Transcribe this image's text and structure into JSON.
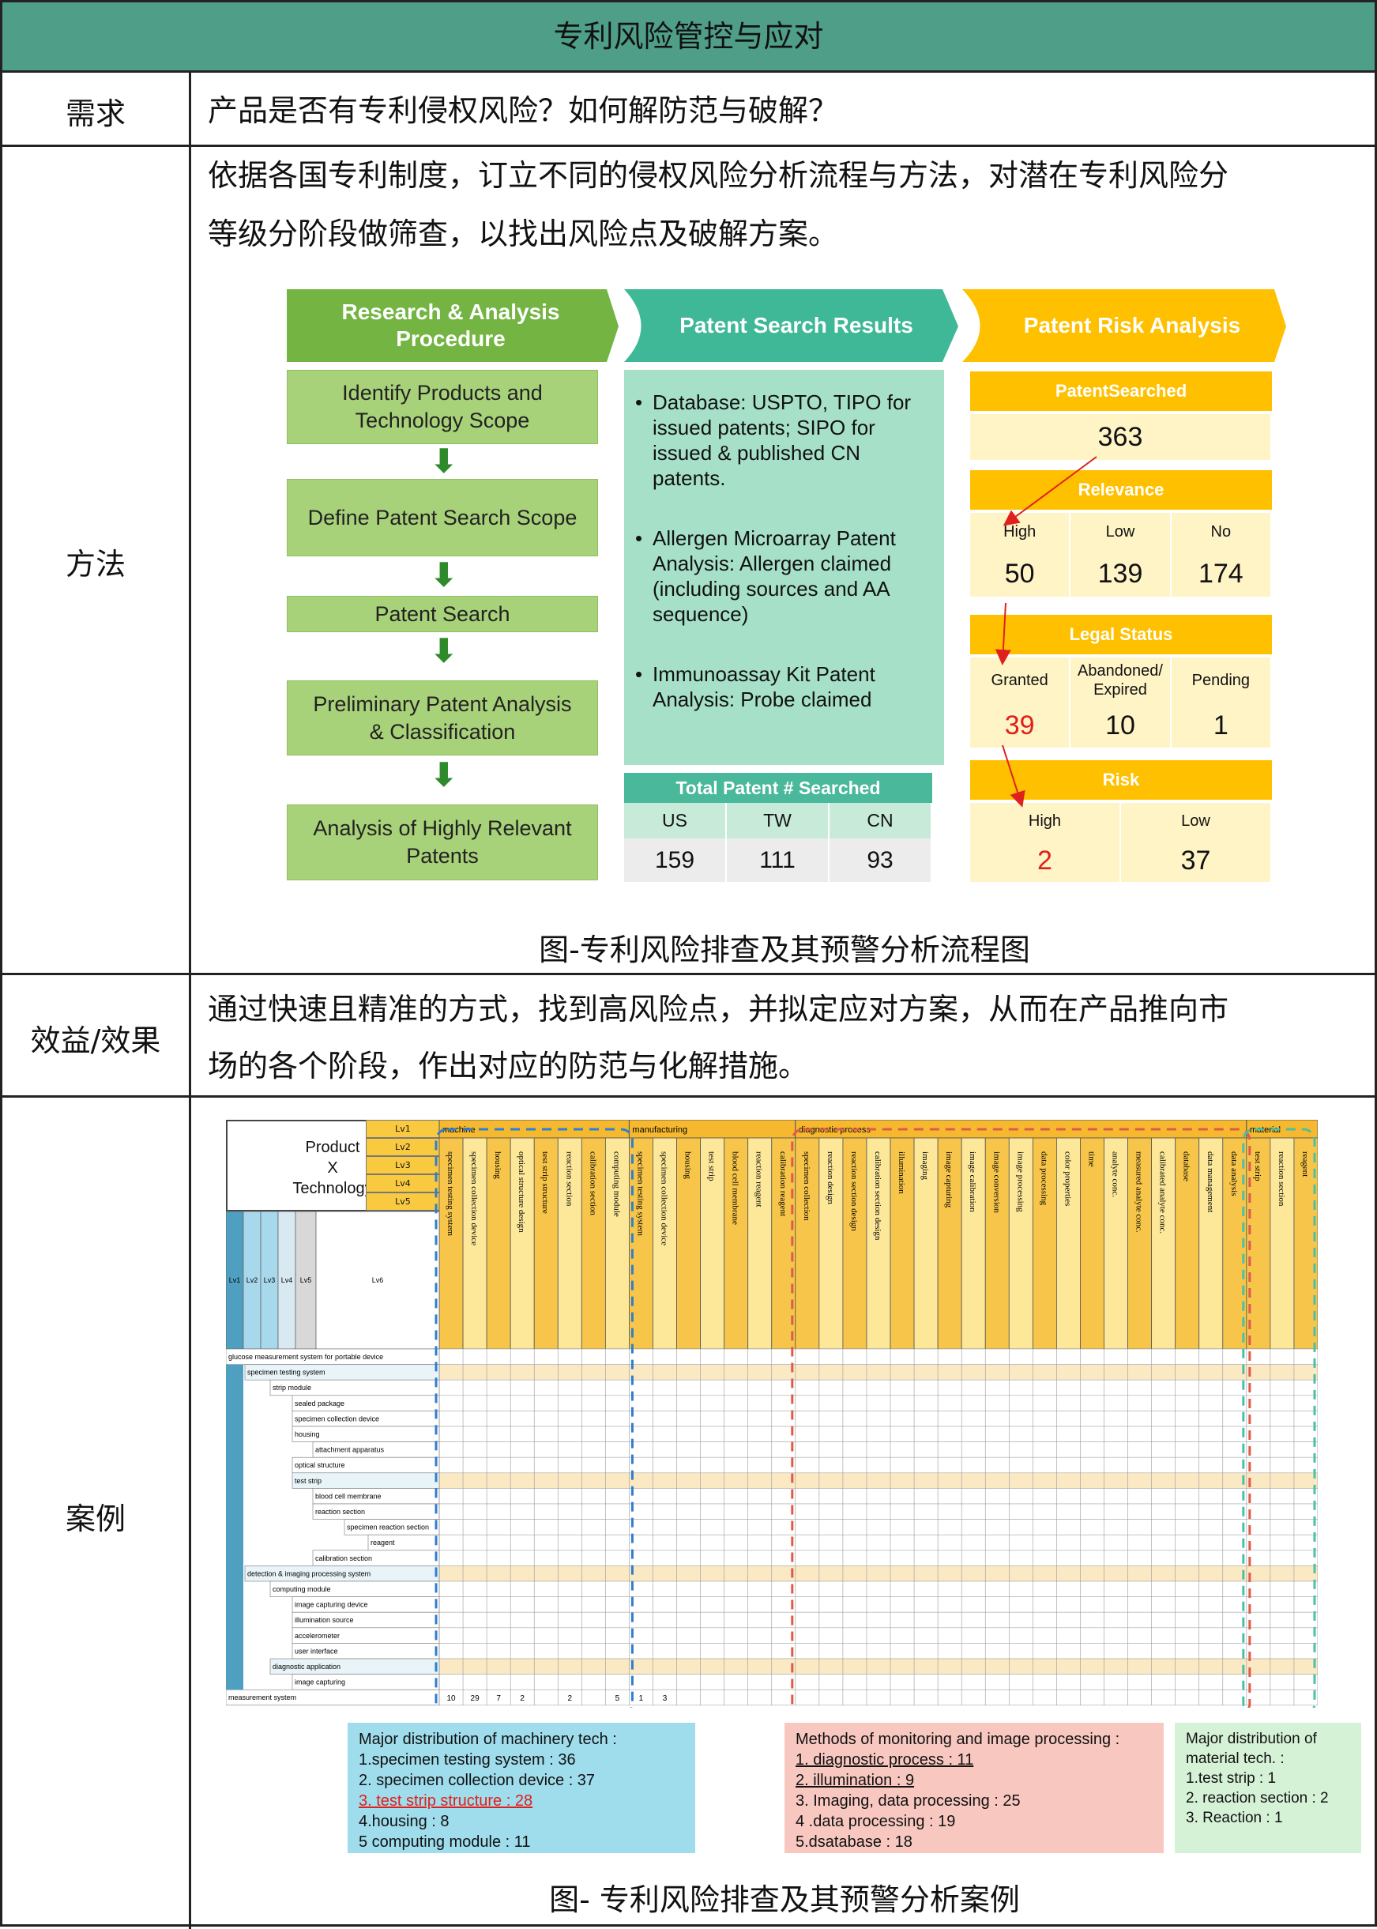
{
  "title": "专利风险管控与应对",
  "rows": {
    "need": {
      "label": "需求",
      "text": "产品是否有专利侵权风险？如何解防范与破解？"
    },
    "method": {
      "label": "方法",
      "text_line1": "依据各国专利制度，订立不同的侵权风险分析流程与方法，对潜在专利风险分",
      "text_line2": "等级分阶段做筛查，以找出风险点及破解方案。",
      "caption": "图-专利风险排查及其预警分析流程图"
    },
    "benefit": {
      "label": "效益/效果",
      "text_line1": "通过快速且精准的方式，找到高风险点，并拟定应对方案，从而在产品推向市",
      "text_line2": "场的各个阶段，作出对应的防范与化解措施。"
    },
    "case": {
      "label": "案例",
      "caption": "图- 专利风险排查及其预警分析案例"
    }
  },
  "flow": {
    "chevrons": [
      "Research & Analysis Procedure",
      "Patent Search Results",
      "Patent Risk Analysis"
    ],
    "chevron_colors": [
      "#74b443",
      "#3fb897",
      "#ffc000"
    ],
    "steps": [
      "Identify Products and Technology Scope",
      "Define Patent Search Scope",
      "Patent Search",
      "Preliminary Patent Analysis & Classification",
      "Analysis of Highly Relevant Patents"
    ],
    "bullets": [
      "Database: USPTO, TIPO for issued patents; SIPO for issued & published CN patents.",
      "Allergen Microarray Patent Analysis: Allergen claimed (including sources and AA sequence)",
      "Immunoassay Kit Patent Analysis: Probe claimed"
    ],
    "total": {
      "title": "Total Patent # Searched",
      "labels": [
        "US",
        "TW",
        "CN"
      ],
      "values": [
        "159",
        "111",
        "93"
      ]
    },
    "risk": {
      "searched_title": "PatentSearched",
      "searched_value": "363",
      "relevance_title": "Relevance",
      "relevance_labels": [
        "High",
        "Low",
        "No"
      ],
      "relevance_values": [
        "50",
        "139",
        "174"
      ],
      "legal_title": "Legal Status",
      "legal_labels": [
        "Granted",
        "Abandoned/ Expired",
        "Pending"
      ],
      "legal_values": [
        "39",
        "10",
        "1"
      ],
      "risk_title": "Risk",
      "risk_labels": [
        "High",
        "Low"
      ],
      "risk_values": [
        "2",
        "37"
      ]
    }
  },
  "matrix": {
    "corner": [
      "Product",
      "X",
      "Technology"
    ],
    "lv_tags": [
      "Lv1",
      "Lv2",
      "Lv3",
      "Lv4",
      "Lv5"
    ],
    "left_levels": [
      "Lv1",
      "Lv2",
      "Lv3",
      "Lv4",
      "Lv5",
      "Lv6"
    ],
    "lv1_groups": [
      "machine",
      "manufacturing",
      "diagnostic process",
      "material"
    ],
    "machine_cols": [
      "specimen testing system",
      "specimen collection device",
      "housing",
      "optical structure design",
      "test strip structure",
      "reaction section",
      "calibration section",
      "computing module"
    ],
    "manufacturing_cols": [
      "specimen testing system",
      "specimen collection device",
      "housing",
      "test strip",
      "blood cell membrane",
      "reaction reagent",
      "calibration reagent"
    ],
    "diagnostic_cols": [
      "specimen collection",
      "reaction design",
      "reaction section design",
      "calibration section design",
      "illumination",
      "imaging",
      "image capturing",
      "image calibration",
      "image conversion",
      "image processing",
      "data processing",
      "color properties",
      "time",
      "analyte conc.",
      "measured analyte conc.",
      "calibrated analyte conc.",
      "database",
      "data management",
      "data analysis"
    ],
    "material_cols": [
      "test strip",
      "reaction section",
      "reagent"
    ],
    "row_labels": [
      "glucose measurement system for portable device",
      "specimen testing system",
      "strip module",
      "sealed package",
      "specimen collection device",
      "housing",
      "attachment apparatus",
      "optical structure",
      "test strip",
      "blood cell membrane",
      "reaction section",
      "specimen reaction section",
      "reagent",
      "calibration section",
      "detection & imaging processing system",
      "computing module",
      "image capturing device",
      "illumination source",
      "accelerometer",
      "user interface",
      "diagnostic application",
      "image capturing",
      "measurement system"
    ],
    "totals_row": [
      "10",
      "29",
      "7",
      "2",
      "",
      "2",
      "",
      "5",
      "1",
      "3"
    ]
  },
  "boxes": {
    "machinery": {
      "title": "Major distribution of machinery tech :",
      "items": [
        "1.specimen testing system : 36",
        "2. specimen collection device : 37",
        "3. test strip structure : 28",
        "4.housing : 8",
        "5 computing module : 11"
      ],
      "color": "#9fdcec"
    },
    "methods": {
      "title": "Methods of monitoring and image processing :",
      "items": [
        "1. diagnostic process : 11",
        "2. illumination : 9",
        "3. Imaging, data processing : 25",
        "4 .data processing : 19",
        "5.dsatabase : 18"
      ],
      "color": "#f8c8c0"
    },
    "material": {
      "title": "Major distribution of material tech. :",
      "items": [
        "1.test strip : 1",
        "2. reaction section : 2",
        "3. Reaction : 1"
      ],
      "color": "#d6f2d6"
    }
  }
}
